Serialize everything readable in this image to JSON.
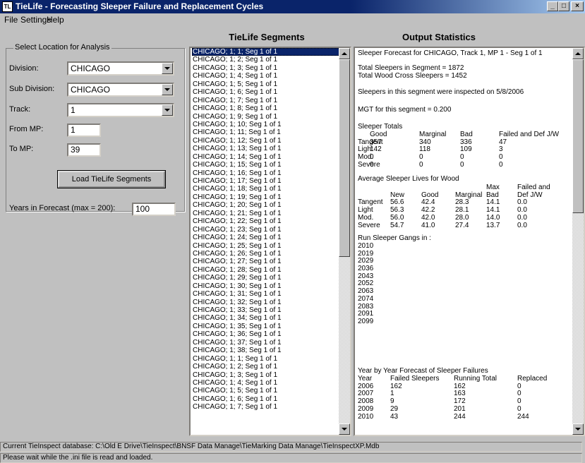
{
  "window": {
    "title": "TieLife - Forecasting Sleeper Failure and Replacement Cycles",
    "icon_label": "TL",
    "controls": [
      "_",
      "□",
      "×"
    ]
  },
  "menu": [
    "File",
    "Settings",
    "Help"
  ],
  "location": {
    "group_label": "Select Location for Analysis",
    "division_label": "Division:",
    "division_value": "CHICAGO",
    "subdivision_label": "Sub Division:",
    "subdivision_value": "CHICAGO",
    "track_label": "Track:",
    "track_value": "1",
    "from_mp_label": "From MP:",
    "from_mp_value": "1",
    "to_mp_label": "To MP:",
    "to_mp_value": "39",
    "load_button": "Load TieLife Segments",
    "years_label": "Years in Forecast (max = 200):",
    "years_value": "100"
  },
  "segments": {
    "title": "TieLife Segments",
    "selected_index": 0,
    "items": [
      "CHICAGO; 1; 1; Seg 1 of 1",
      "CHICAGO; 1; 2; Seg 1 of 1",
      "CHICAGO; 1; 3; Seg 1 of 1",
      "CHICAGO; 1; 4; Seg 1 of 1",
      "CHICAGO; 1; 5; Seg 1 of 1",
      "CHICAGO; 1; 6; Seg 1 of 1",
      "CHICAGO; 1; 7; Seg 1 of 1",
      "CHICAGO; 1; 8; Seg 1 of 1",
      "CHICAGO; 1; 9; Seg 1 of 1",
      "CHICAGO; 1; 10; Seg 1 of 1",
      "CHICAGO; 1; 11; Seg 1 of 1",
      "CHICAGO; 1; 12; Seg 1 of 1",
      "CHICAGO; 1; 13; Seg 1 of 1",
      "CHICAGO; 1; 14; Seg 1 of 1",
      "CHICAGO; 1; 15; Seg 1 of 1",
      "CHICAGO; 1; 16; Seg 1 of 1",
      "CHICAGO; 1; 17; Seg 1 of 1",
      "CHICAGO; 1; 18; Seg 1 of 1",
      "CHICAGO; 1; 19; Seg 1 of 1",
      "CHICAGO; 1; 20; Seg 1 of 1",
      "CHICAGO; 1; 21; Seg 1 of 1",
      "CHICAGO; 1; 22; Seg 1 of 1",
      "CHICAGO; 1; 23; Seg 1 of 1",
      "CHICAGO; 1; 24; Seg 1 of 1",
      "CHICAGO; 1; 25; Seg 1 of 1",
      "CHICAGO; 1; 26; Seg 1 of 1",
      "CHICAGO; 1; 27; Seg 1 of 1",
      "CHICAGO; 1; 28; Seg 1 of 1",
      "CHICAGO; 1; 29; Seg 1 of 1",
      "CHICAGO; 1; 30; Seg 1 of 1",
      "CHICAGO; 1; 31; Seg 1 of 1",
      "CHICAGO; 1; 32; Seg 1 of 1",
      "CHICAGO; 1; 33; Seg 1 of 1",
      "CHICAGO; 1; 34; Seg 1 of 1",
      "CHICAGO; 1; 35; Seg 1 of 1",
      "CHICAGO; 1; 36; Seg 1 of 1",
      "CHICAGO; 1; 37; Seg 1 of 1",
      "CHICAGO; 1; 38; Seg 1 of 1",
      "CHICAGO; 1; 1; Seg 1 of 1",
      "CHICAGO; 1; 2; Seg 1 of 1",
      "CHICAGO; 1; 3; Seg 1 of 1",
      "CHICAGO; 1; 4; Seg 1 of 1",
      "CHICAGO; 1; 5; Seg 1 of 1",
      "CHICAGO; 1; 6; Seg 1 of 1",
      "CHICAGO; 1; 7; Seg 1 of 1"
    ]
  },
  "output": {
    "title": "Output Statistics",
    "forecast_header": "Sleeper Forecast for CHICAGO, Track 1, MP 1 - Seg 1 of 1",
    "total_sleepers": "Total Sleepers in Segment = 1872",
    "total_wood": "Total Wood Cross Sleepers = 1452",
    "inspected": "Sleepers in this segment were inspected on 5/8/2006",
    "mgt": "MGT for this segment = 0.200",
    "totals_title": "Sleeper Totals",
    "totals_headers": [
      "",
      "Good",
      "Marginal",
      "Bad",
      "Failed and Def J/W"
    ],
    "totals_rows": [
      [
        "Tangent",
        "357",
        "340",
        "336",
        "47"
      ],
      [
        "Light",
        "142",
        "118",
        "109",
        "3"
      ],
      [
        "Mod.",
        "0",
        "0",
        "0",
        "0"
      ],
      [
        "Severe",
        "0",
        "0",
        "0",
        "0"
      ]
    ],
    "lives_title": "Average Sleeper Lives for Wood",
    "lives_headers_top": [
      "",
      "",
      "",
      "",
      "Max",
      "Failed and"
    ],
    "lives_headers": [
      "",
      "New",
      "Good",
      "Marginal",
      "Bad",
      "Def J/W"
    ],
    "lives_rows": [
      [
        "Tangent",
        "56.6",
        "42.4",
        "28.3",
        "14.1",
        "0.0"
      ],
      [
        "Light",
        "56.3",
        "42.2",
        "28.1",
        "14.1",
        "0.0"
      ],
      [
        "Mod.",
        "56.0",
        "42.0",
        "28.0",
        "14.0",
        "0.0"
      ],
      [
        "Severe",
        "54.7",
        "41.0",
        "27.4",
        "13.7",
        "0.0"
      ]
    ],
    "gangs_title": "Run Sleeper Gangs in :",
    "gang_years": [
      "2010",
      "2019",
      "2029",
      "2036",
      "2043",
      "2052",
      "2063",
      "2074",
      "2083",
      "2091",
      "2099"
    ],
    "yby_title": "Year by Year Forecast of Sleeper Failures",
    "yby_headers": [
      "Year",
      "Failed Sleepers",
      "Running Total",
      "Replaced"
    ],
    "yby_rows": [
      [
        "2006",
        "162",
        "162",
        "0"
      ],
      [
        "2007",
        "1",
        "163",
        "0"
      ],
      [
        "2008",
        "9",
        "172",
        "0"
      ],
      [
        "2009",
        "29",
        "201",
        "0"
      ],
      [
        "2010",
        "43",
        "244",
        "244"
      ]
    ]
  },
  "status": {
    "database": "Current TieInspect database: C:\\Old E Drive\\TieInspect\\BNSF Data Manage\\TieMarking Data Manage\\TieInspectXP.Mdb",
    "message": "Please wait while the .ini file is read and loaded."
  }
}
